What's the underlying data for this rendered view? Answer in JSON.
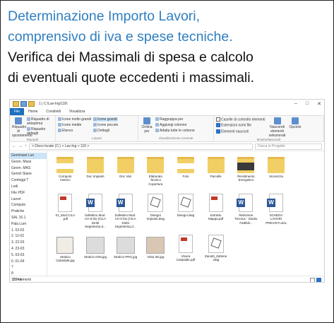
{
  "heading": {
    "line1": "Determinazione Importo Lavori,",
    "line2": "comprensivo di iva e spese tecniche.",
    "line3": "Verifica dei Massimali di spesa e calcolo",
    "line4": "di eventuali quote eccedenti i massimali."
  },
  "colors": {
    "heading_blue": "#2f7fc0",
    "file_tab": "#1d6fc1",
    "folder": "#f2cf64",
    "word": "#2b5797",
    "pdf": "#c0392b"
  },
  "explorer": {
    "title": "1 | C:\\Lav-Ing\\110\\",
    "window_controls": [
      "–",
      "□",
      "✕"
    ],
    "tabs": [
      "File",
      "Home",
      "Condividi",
      "Visualizza"
    ],
    "ribbon": {
      "layout_items": [
        "Icone molto grandi",
        "Icone grandi",
        "Icone medie",
        "Icone piccole",
        "Elenco",
        "Dettagli"
      ],
      "pane_items": [
        "Riquadro di anteprima",
        "Riquadro dettagli",
        "Riquadro di spostamento"
      ],
      "view_items": [
        "Raggruppa per",
        "Aggiungi colonne",
        "Adatta tutte le colonne"
      ],
      "show_items": [
        "Caselle di controllo elementi",
        "Estensioni nomi file",
        "Elementi nascosti"
      ],
      "sort_label": "Ordina per",
      "hide_label": "Nascondi elementi selezionati",
      "options_label": "Opzioni",
      "group_captions": [
        "Riquadri",
        "Layout",
        "Visualizzazione corrente",
        "Mostra/Nascondi"
      ]
    },
    "address": {
      "back": "←",
      "forward": "→",
      "up": "↑",
      "path": "> Disco locale (C:) > Lav-Ing > 110 >",
      "search_placeholder": "Cerca in Progetto"
    },
    "nav_items": [
      "Geminiani Lun",
      "Geom. Mass",
      "Geom. MAS",
      "Geniol Stane",
      "Conteggi T",
      "Lodi",
      "File PDF",
      "Lavori",
      "Computo",
      "Pratiche",
      "SAL 16.1",
      "Pala Lum",
      "1. 03-02",
      "2. 11-02",
      "3. 22-03",
      "4. 23-03",
      "5. 03-03",
      "6. 01-04",
      "7",
      "8",
      "10 Pro"
    ],
    "files": [
      {
        "label": "Computo metrico",
        "kind": "folder-filled"
      },
      {
        "label": "Doc Impianti",
        "kind": "folder"
      },
      {
        "label": "Doc Vari",
        "kind": "folder"
      },
      {
        "label": "Elaborato Tecnico Copertura",
        "kind": "folder"
      },
      {
        "label": "Foto",
        "kind": "folder-filled"
      },
      {
        "label": "Parcelle",
        "kind": "folder"
      },
      {
        "label": "Rendimento Energetico",
        "kind": "folder-dark"
      },
      {
        "label": "Sicurezza",
        "kind": "folder"
      },
      {
        "label": "",
        "kind": "empty"
      },
      {
        "label": "01_Mod CILA .pdf",
        "kind": "pdf"
      },
      {
        "label": "bollettino Mod. CH 8 bis (CILA Diritti Segreteria).d...",
        "kind": "word"
      },
      {
        "label": "bollettino Mod. CH 8 bis (CILA Diritti Segreteria).d...",
        "kind": "word"
      },
      {
        "label": "Disegni Impianti.dwg",
        "kind": "dwg"
      },
      {
        "label": "Disegni.dwg",
        "kind": "dwg"
      },
      {
        "label": "Estratto Mappa.pdf",
        "kind": "pdf"
      },
      {
        "label": "Relazione Tecnica - Studio Fattibili...",
        "kind": "word"
      },
      {
        "label": "SCHEDA LAVORI PREVISTI.xlsx",
        "kind": "word"
      },
      {
        "label": "",
        "kind": "empty"
      },
      {
        "label": "Stralcio Catastale.jpg",
        "kind": "sketch"
      },
      {
        "label": "Stralcio IGM.jpg",
        "kind": "img"
      },
      {
        "label": "Stralcio PRG.jpg",
        "kind": "img"
      },
      {
        "label": "Vista 3D.jpg",
        "kind": "img-house"
      },
      {
        "label": "Visura Catastale.pdf",
        "kind": "pdf"
      },
      {
        "label": "Zanotti_Zattone .dwg",
        "kind": "dwg"
      }
    ],
    "status": "21 elementi"
  }
}
